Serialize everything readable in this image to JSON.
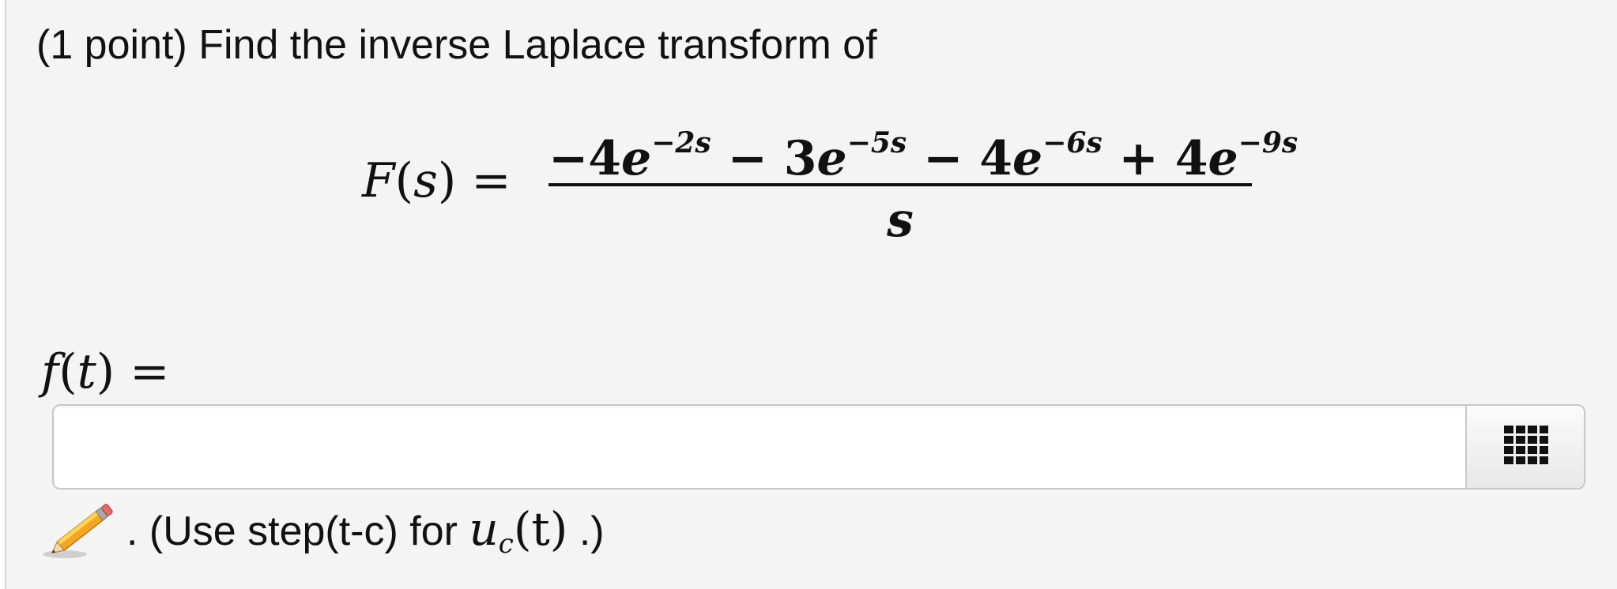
{
  "problem": {
    "prompt": "(1 point) Find the inverse Laplace transform of"
  },
  "equation": {
    "lhs_func": "F",
    "lhs_var": "s",
    "equals": "=",
    "numerator": [
      {
        "sign": "−",
        "coef": "4",
        "base": "e",
        "exp": "−2s"
      },
      {
        "sign": " − ",
        "coef": "3",
        "base": "e",
        "exp": "−5s"
      },
      {
        "sign": " − ",
        "coef": "4",
        "base": "e",
        "exp": "−6s"
      },
      {
        "sign": " + ",
        "coef": "4",
        "base": "e",
        "exp": "−9s"
      }
    ],
    "denominator": "s"
  },
  "answer": {
    "label_func": "f",
    "label_var": "t",
    "equals": "=",
    "value": "",
    "placeholder": ""
  },
  "hint": {
    "prefix": ". (Use step(t-c) for ",
    "math_base": "u",
    "math_sub": "c",
    "math_arg": "(t)",
    "suffix": " .)"
  },
  "icons": {
    "pencil": "pencil-icon",
    "palette": "equation-palette-icon"
  },
  "colors": {
    "panel_bg": "#f4f4f4",
    "input_border": "#c8c8c8",
    "text": "#111111"
  }
}
